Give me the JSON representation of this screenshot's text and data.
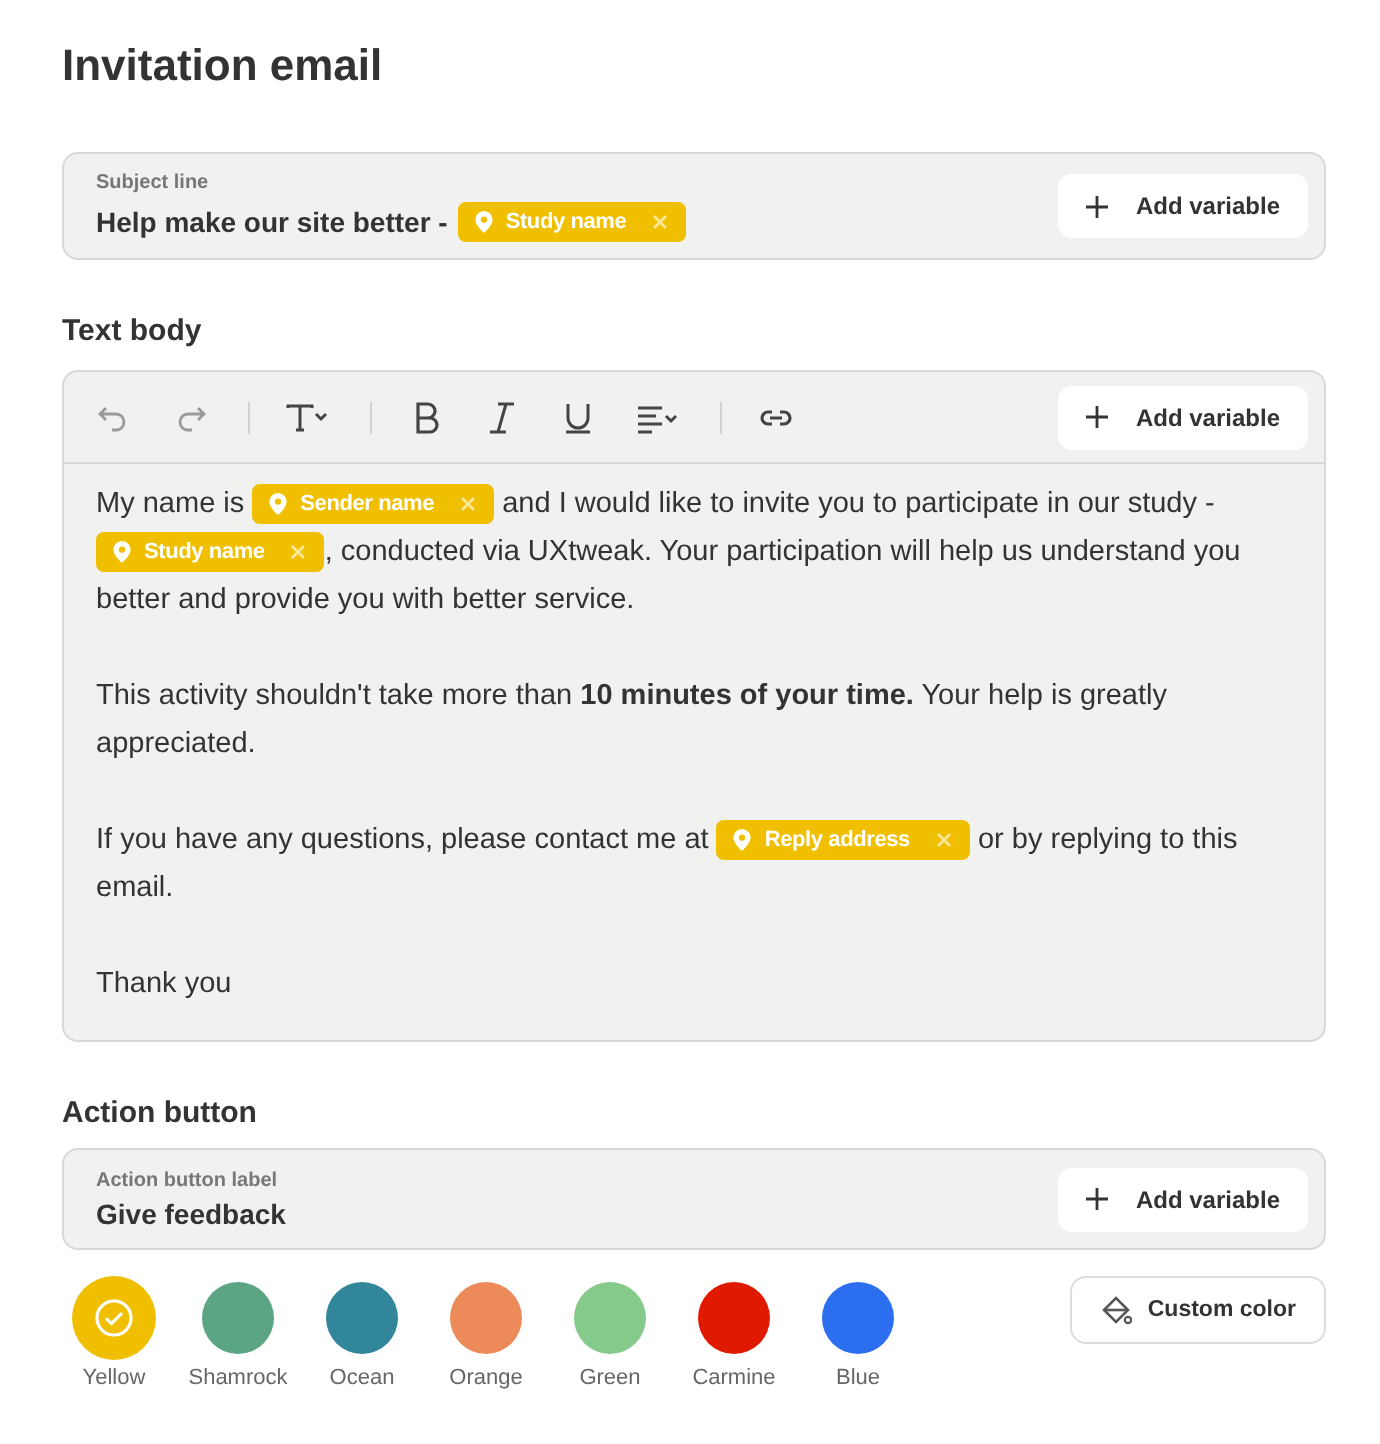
{
  "title": "Invitation email",
  "subject": {
    "label": "Subject line",
    "value": "Help make our site better -",
    "variables": [
      "Study name"
    ],
    "add_button": "Add variable"
  },
  "text_body": {
    "heading": "Text body",
    "toolbar": [
      {
        "kind": "undo",
        "disabled": true
      },
      {
        "kind": "redo",
        "disabled": true
      },
      {
        "kind": "text-style",
        "disabled": false
      },
      {
        "kind": "bold",
        "disabled": false
      },
      {
        "kind": "italic",
        "disabled": false
      },
      {
        "kind": "underline",
        "disabled": false
      },
      {
        "kind": "align",
        "disabled": false
      },
      {
        "kind": "link",
        "disabled": false
      }
    ],
    "add_button": "Add variable",
    "paragraphs": [
      [
        {
          "kind": "text",
          "text": "My name is"
        },
        {
          "kind": "variable",
          "text": "Sender name"
        },
        {
          "kind": "text",
          "text": "and I would like to invite you to participate in our study -"
        },
        {
          "kind": "variable",
          "text": "Study name"
        },
        {
          "kind": "text",
          "text": ", conducted via UXtweak. Your participation will help us understand you"
        },
        {
          "kind": "text",
          "text": "better and provide you with better service."
        }
      ],
      [
        {
          "kind": "text",
          "text": "This activity shouldn't take more than **10 minutes of your time.** Your help is greatly appreciated."
        }
      ],
      [
        {
          "kind": "text",
          "text": "If you have any questions, please contact me at"
        },
        {
          "kind": "variable",
          "text": "Reply address"
        },
        {
          "kind": "text",
          "text": "or by replying to this"
        },
        {
          "kind": "text",
          "text": "email."
        }
      ],
      [
        {
          "kind": "text",
          "text": "Thank you"
        }
      ]
    ]
  },
  "action_button": {
    "heading": "Action button",
    "label": "Action button label",
    "value": "Give feedback",
    "add_button": "Add variable"
  },
  "colors": [
    {
      "name": "Yellow",
      "color": "#f0c000",
      "selected": true
    },
    {
      "name": "Shamrock",
      "color": "#5ba585",
      "selected": false
    },
    {
      "name": "Ocean",
      "color": "#32869a",
      "selected": false
    },
    {
      "name": "Orange",
      "color": "#ec8a59",
      "selected": false
    },
    {
      "name": "Green",
      "color": "#85c98b",
      "selected": false
    },
    {
      "name": "Carmine",
      "color": "#e01a00",
      "selected": false
    },
    {
      "name": "Blue",
      "color": "#2b6ff0",
      "selected": false
    }
  ],
  "custom_color_button": "Custom color"
}
